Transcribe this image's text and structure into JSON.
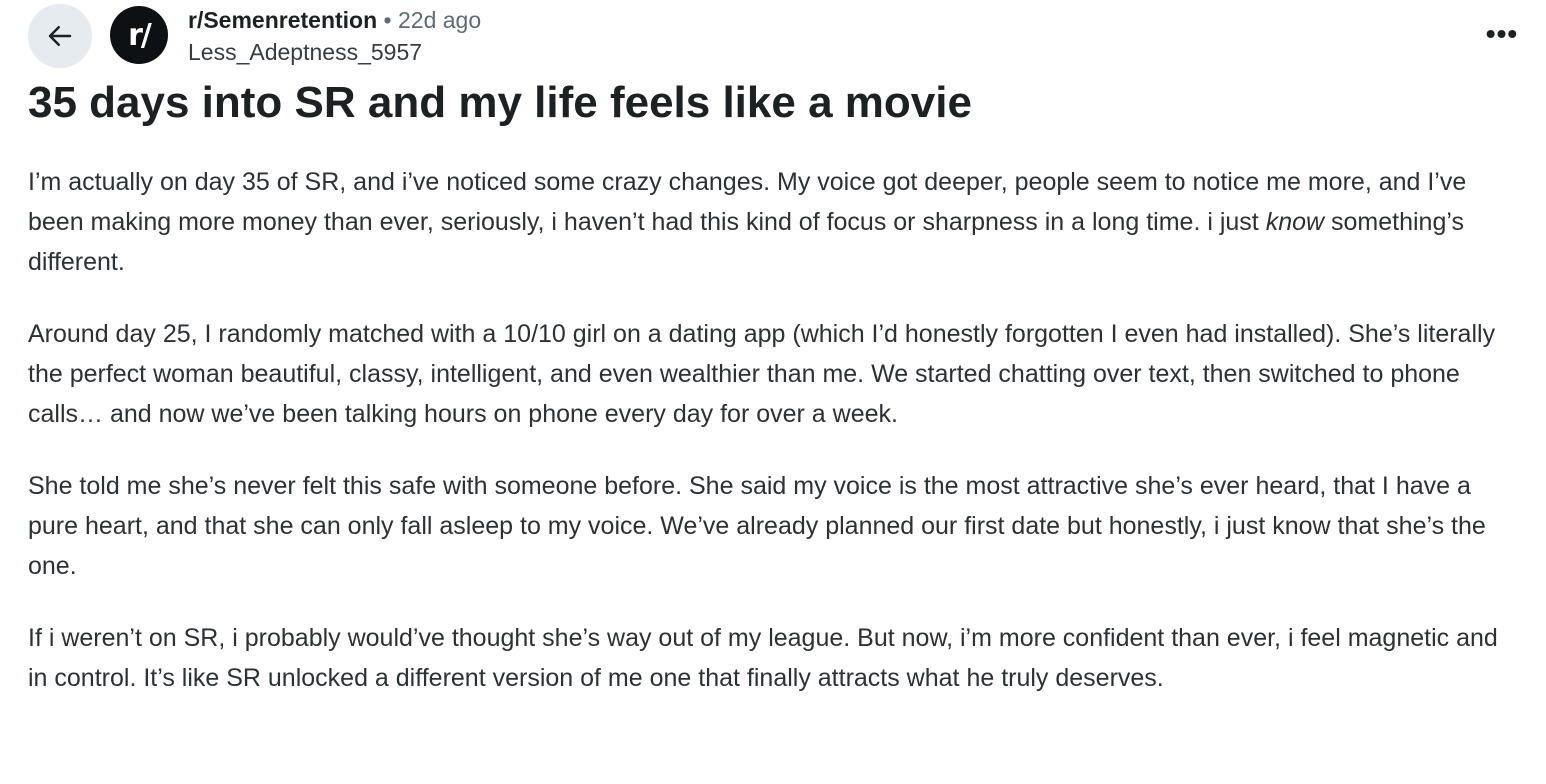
{
  "post": {
    "subreddit": "r/Semenretention",
    "separator": "•",
    "time": "22d ago",
    "author": "Less_Adeptness_5957",
    "avatar_text": "r/",
    "more_label": "•••",
    "title": "35 days into SR and my life feels like a movie",
    "p1_before": "I’m actually on day 35 of SR, and i’ve noticed some crazy changes. My voice got deeper, people seem to notice me more, and I’ve been making more money than ever, seriously, i haven’t had this kind of focus or sharpness in a long time. i just ",
    "p1_emph": "know",
    "p1_after": " something’s different.",
    "p2": "Around day 25, I randomly matched with a 10/10 girl on a dating app (which I’d honestly forgotten I even had installed). She’s literally the perfect woman beautiful, classy, intelligent, and even wealthier than me. We started chatting over text, then switched to phone calls… and now we’ve been talking hours on phone every day for over a week.",
    "p3": "She told me she’s never felt this safe with someone before. She said my voice is the most attractive she’s ever heard, that I have a pure heart, and that she can only fall asleep to my voice. We’ve already planned our first date but honestly, i just know that she’s the one.",
    "p4": "If i weren’t on SR, i probably would’ve thought she’s way out of my league. But now, i’m more confident than ever, i feel magnetic and in control. It’s like SR unlocked a different version of me one that finally attracts what he truly deserves."
  },
  "icons": {
    "back": "arrow-left-icon",
    "more": "more-horizontal-icon"
  },
  "colors": {
    "back_button_bg": "#e5ebee",
    "avatar_bg": "#0e1113",
    "text": "#1c2124",
    "muted": "#5c6c74"
  }
}
